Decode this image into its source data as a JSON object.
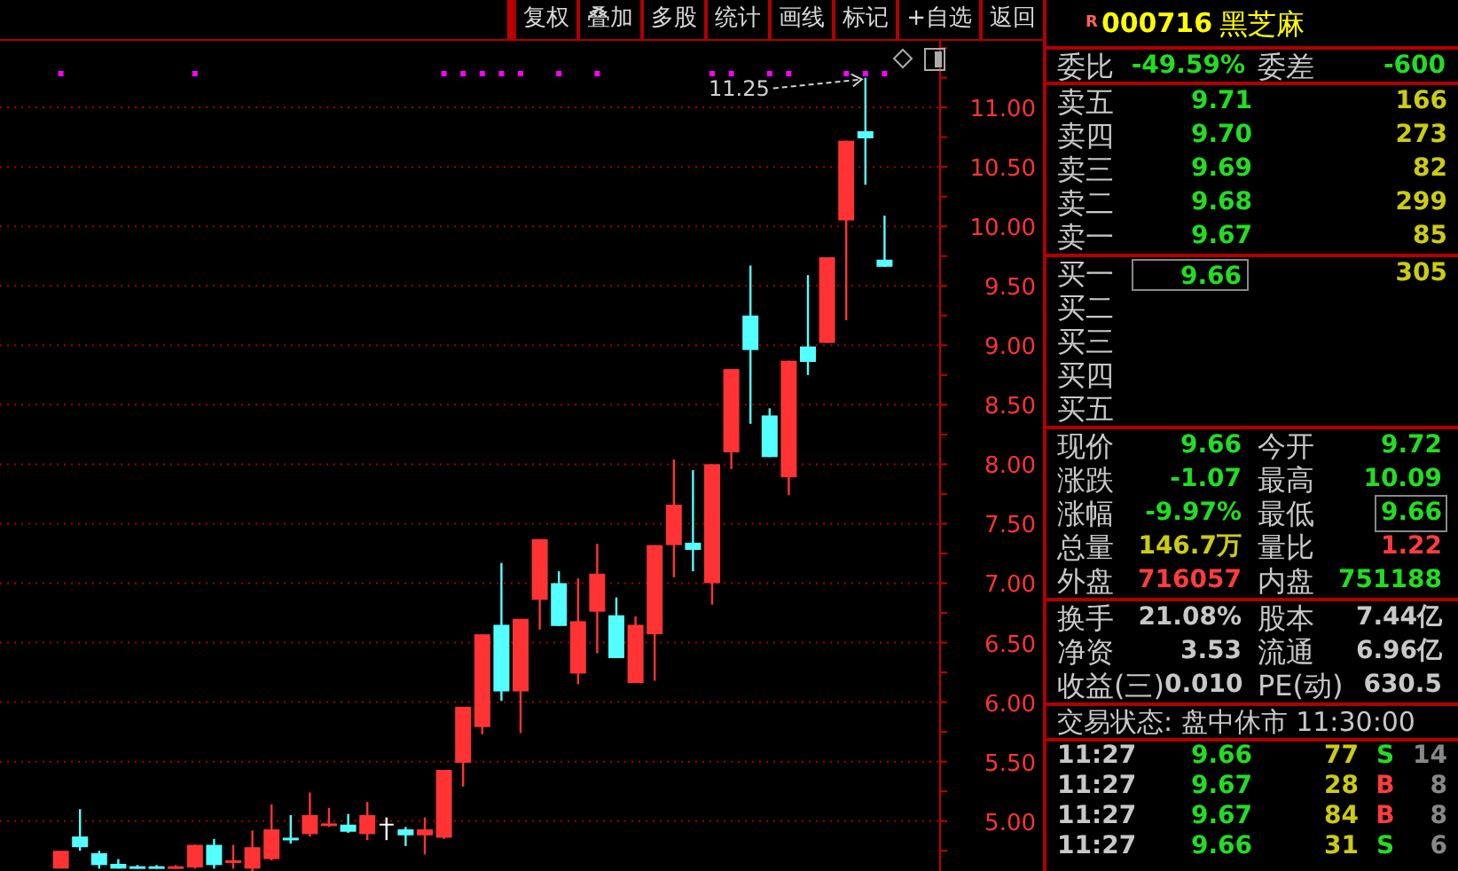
{
  "toolbar": {
    "buttons": [
      "复权",
      "叠加",
      "多股",
      "统计",
      "画线",
      "标记",
      "+自选",
      "返回"
    ]
  },
  "chart": {
    "chart_data": {
      "type": "candlestick",
      "ylim": [
        4.58,
        11.56
      ],
      "grid": true,
      "yticks": [
        {
          "value": 5,
          "label": "5.00"
        },
        {
          "value": 5.5,
          "label": "5.50"
        },
        {
          "value": 6,
          "label": "6.00"
        },
        {
          "value": 6.5,
          "label": "6.50"
        },
        {
          "value": 7,
          "label": "7.00"
        },
        {
          "value": 7.5,
          "label": "7.50"
        },
        {
          "value": 8,
          "label": "8.00"
        },
        {
          "value": 8.5,
          "label": "8.50"
        },
        {
          "value": 9,
          "label": "9.00"
        },
        {
          "value": 9.5,
          "label": "9.50"
        },
        {
          "value": 10,
          "label": "10.00"
        },
        {
          "value": 10.5,
          "label": "10.50"
        },
        {
          "value": 11,
          "label": "11.00"
        }
      ],
      "ohlc": [
        [
          4.6,
          4.75,
          4.6,
          4.75
        ],
        [
          4.87,
          5.1,
          4.75,
          4.78
        ],
        [
          4.73,
          4.75,
          4.6,
          4.63
        ],
        [
          4.64,
          4.68,
          4.6,
          4.6
        ],
        [
          4.62,
          4.63,
          4.6,
          4.6
        ],
        [
          4.62,
          4.63,
          4.6,
          4.6
        ],
        [
          4.6,
          4.63,
          4.6,
          4.62
        ],
        [
          4.61,
          4.8,
          4.6,
          4.8
        ],
        [
          4.8,
          4.85,
          4.6,
          4.63
        ],
        [
          4.65,
          4.8,
          4.6,
          4.67
        ],
        [
          4.6,
          4.92,
          4.58,
          4.78
        ],
        [
          4.68,
          5.14,
          4.67,
          4.93
        ],
        [
          4.86,
          5.05,
          4.81,
          4.84
        ],
        [
          4.89,
          5.24,
          4.87,
          5.05
        ],
        [
          4.97,
          5.11,
          4.95,
          4.98
        ],
        [
          4.97,
          5.06,
          4.9,
          4.91
        ],
        [
          4.89,
          5.16,
          4.84,
          5.05
        ],
        [
          4.97,
          5.03,
          4.84,
          4.97
        ],
        [
          4.93,
          4.95,
          4.79,
          4.88
        ],
        [
          4.88,
          5.03,
          4.72,
          4.93
        ],
        [
          4.86,
          5.43,
          4.85,
          5.43
        ],
        [
          5.49,
          5.96,
          5.29,
          5.96
        ],
        [
          5.79,
          6.57,
          5.73,
          6.57
        ],
        [
          6.65,
          7.17,
          6.01,
          6.09
        ],
        [
          6.09,
          6.7,
          5.74,
          6.7
        ],
        [
          6.86,
          7.37,
          6.61,
          7.37
        ],
        [
          7.0,
          7.1,
          6.64,
          6.64
        ],
        [
          6.24,
          7.04,
          6.15,
          6.68
        ],
        [
          6.76,
          7.33,
          6.41,
          7.08
        ],
        [
          6.73,
          6.88,
          6.37,
          6.37
        ],
        [
          6.16,
          6.72,
          6.16,
          6.65
        ],
        [
          6.57,
          7.32,
          6.18,
          7.32
        ],
        [
          7.32,
          8.04,
          7.05,
          7.66
        ],
        [
          7.34,
          7.95,
          7.1,
          7.28
        ],
        [
          7.0,
          8.0,
          6.82,
          8.0
        ],
        [
          8.1,
          8.8,
          7.96,
          8.8
        ],
        [
          9.25,
          9.67,
          8.34,
          8.96
        ],
        [
          8.41,
          8.47,
          8.06,
          8.06
        ],
        [
          7.89,
          8.87,
          7.74,
          8.87
        ],
        [
          8.99,
          9.59,
          8.75,
          8.86
        ],
        [
          9.02,
          9.74,
          9.02,
          9.74
        ],
        [
          10.05,
          10.72,
          9.21,
          10.72
        ],
        [
          10.8,
          11.25,
          10.35,
          10.74
        ],
        [
          9.72,
          10.09,
          9.66,
          9.66
        ]
      ],
      "annotations": [
        "11.25"
      ]
    }
  },
  "quote": {
    "flag": "R",
    "code": "000716",
    "name": "黑芝麻"
  },
  "commission": [
    {
      "label": "委比",
      "value": "-49.59%"
    },
    {
      "label": "委差",
      "value": "-600"
    }
  ],
  "asks": [
    {
      "label": "卖五",
      "price": "9.71",
      "volume": "166"
    },
    {
      "label": "卖四",
      "price": "9.70",
      "volume": "273"
    },
    {
      "label": "卖三",
      "price": "9.69",
      "volume": "82"
    },
    {
      "label": "卖二",
      "price": "9.68",
      "volume": "299"
    },
    {
      "label": "卖一",
      "price": "9.67",
      "volume": "85"
    }
  ],
  "bids": [
    {
      "label": "买一",
      "price": "9.66",
      "volume": "305",
      "selected": true
    },
    {
      "label": "买二",
      "selected": false
    },
    {
      "label": "买三",
      "selected": false
    },
    {
      "label": "买四",
      "selected": false
    },
    {
      "label": "买五",
      "selected": false
    }
  ],
  "stats": [
    {
      "label": "现价",
      "value": "9.66",
      "color": "#22dd22",
      "selected": false
    },
    {
      "label": "今开",
      "value": "9.72",
      "color": "#22dd22",
      "selected": false
    },
    {
      "label": "涨跌",
      "value": "-1.07",
      "color": "#22dd22",
      "selected": false
    },
    {
      "label": "最高",
      "value": "10.09",
      "color": "#22dd22",
      "selected": false
    },
    {
      "label": "涨幅",
      "value": "-9.97%",
      "color": "#22dd22",
      "selected": false
    },
    {
      "label": "最低",
      "value": "9.66",
      "color": "#22dd22",
      "selected": true
    },
    {
      "label": "总量",
      "value": "146.7万",
      "color": "#cccc11",
      "selected": false
    },
    {
      "label": "量比",
      "value": "1.22",
      "color": "#ff3c3c",
      "selected": false
    },
    {
      "label": "外盘",
      "value": "716057",
      "color": "#ff3c3c",
      "selected": false
    },
    {
      "label": "内盘",
      "value": "751188",
      "color": "#22dd22",
      "selected": false
    }
  ],
  "finance": [
    {
      "label": "换手",
      "value": "21.08%"
    },
    {
      "label": "股本",
      "value": "7.44亿"
    },
    {
      "label": "净资",
      "value": "3.53"
    },
    {
      "label": "流通",
      "value": "6.96亿"
    },
    {
      "label": "收益(三)",
      "value": "0.010"
    },
    {
      "label": "PE(动)",
      "value": "630.5"
    }
  ],
  "status": "交易状态: 盘中休市 11:30:00",
  "ticks": [
    {
      "time": "11:27",
      "price": "9.66",
      "volume": "77",
      "side": "S",
      "color": "#22dd22",
      "count": "14"
    },
    {
      "time": "11:27",
      "price": "9.67",
      "volume": "28",
      "side": "B",
      "color": "#ff3c3c",
      "count": "8"
    },
    {
      "time": "11:27",
      "price": "9.67",
      "volume": "84",
      "side": "B",
      "color": "#ff3c3c",
      "count": "8"
    },
    {
      "time": "11:27",
      "price": "9.66",
      "volume": "31",
      "side": "S",
      "color": "#22dd22",
      "count": "6"
    }
  ]
}
